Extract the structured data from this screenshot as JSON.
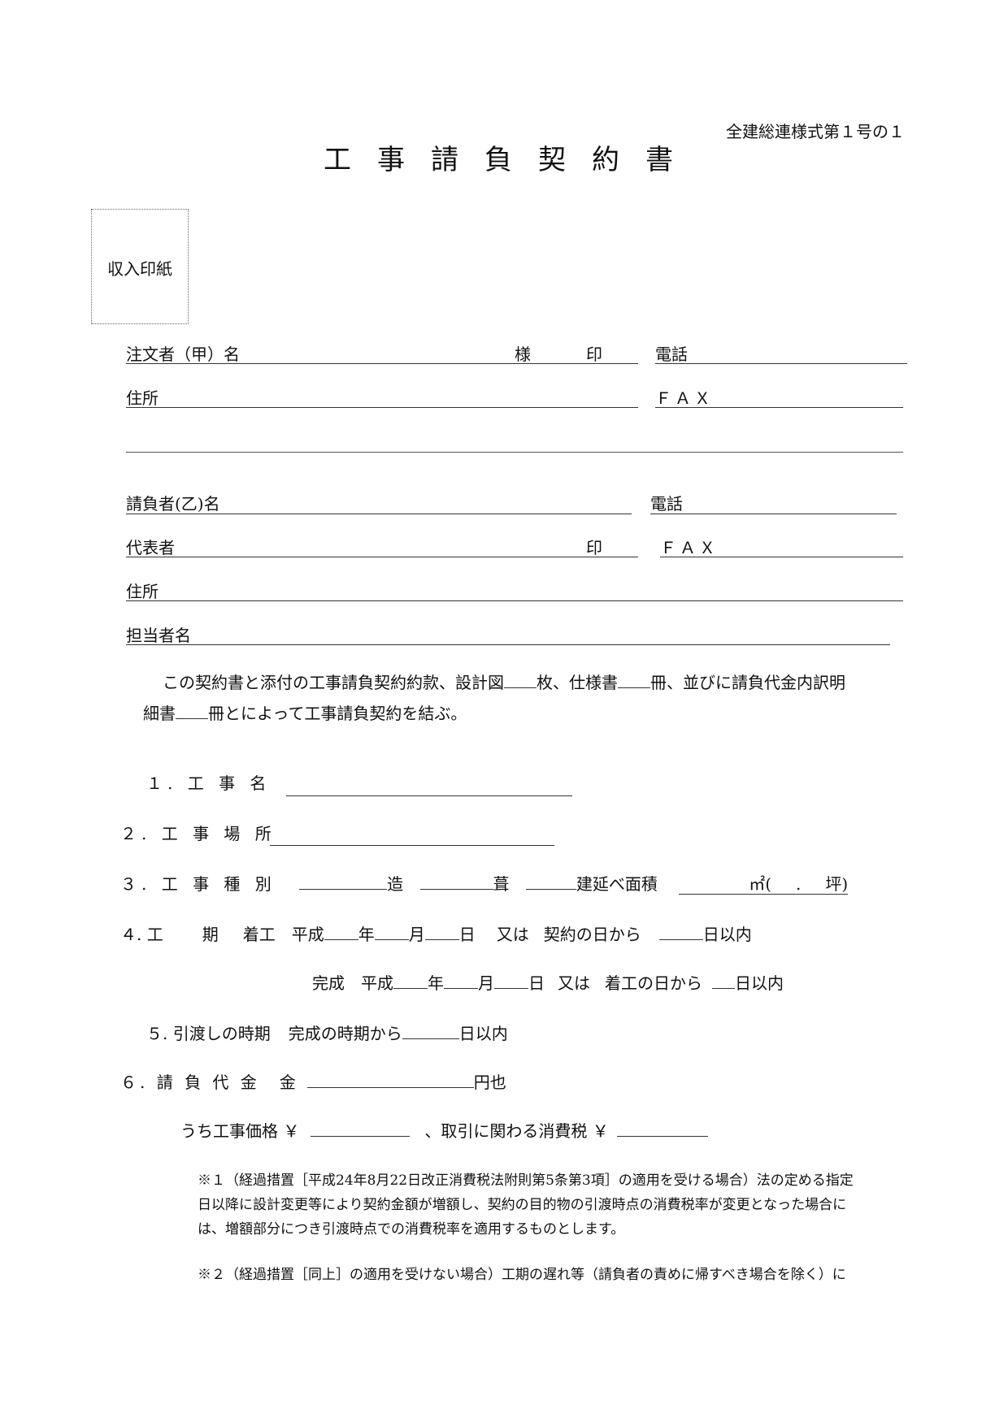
{
  "header": {
    "form_code": "全建総連様式第１号の１",
    "title": "工事請負契約書"
  },
  "stamp": {
    "label": "収入印紙"
  },
  "client": {
    "name_label": "注文者（甲）名",
    "honorific": "様",
    "seal": "印",
    "phone_label": "電話",
    "address_label": "住所",
    "fax_label": "ＦＡＸ",
    "name_value": "",
    "phone_value": "",
    "address_value": "",
    "fax_value": "",
    "address_line2_value": ""
  },
  "contractor": {
    "name_label": "請負者(乙)名",
    "phone_label": "電話",
    "rep_label": "代表者",
    "seal": "印",
    "fax_label": "ＦＡＸ",
    "address_label": "住所",
    "contact_label": "担当者名",
    "name_value": "",
    "phone_value": "",
    "rep_value": "",
    "fax_value": "",
    "address_value": "",
    "contact_value": ""
  },
  "agreement": {
    "p1": "この契約書と添付の工事請負契約約款、設計図",
    "unit_sheets": "枚、仕様書",
    "unit_volumes": "冊、並びに請負代金内訳明",
    "p2a": "細書",
    "p2b": "冊とによって工事請負契約を結ぶ。"
  },
  "items": {
    "i1": {
      "label": "１. 工 事 名",
      "value": ""
    },
    "i2": {
      "label": "２. 工 事 場 所",
      "value": ""
    },
    "i3": {
      "label": "３. 工 事 種 別",
      "structure": "造",
      "roof": "葺",
      "floor_area": "建延べ面積",
      "area_unit": "㎡(",
      "dot": ".",
      "tsubo": "坪)"
    },
    "i4": {
      "label": "４. 工",
      "label2": "期",
      "start": "着工",
      "era": "平成",
      "year": "年",
      "month": "月",
      "day": "日",
      "or": "又は",
      "from_contract": "契約の日から",
      "within": "日以内",
      "complete": "完成",
      "from_start": "着工の日から"
    },
    "i5": {
      "label": "５. 引渡しの時期",
      "text": "完成の時期から",
      "within": "日以内"
    },
    "i6": {
      "label": "６. 請 負 代 金　金",
      "unit": "円也",
      "price_label": "うち工事価格 ￥",
      "tax_label": "、取引に関わる消費税 ￥"
    }
  },
  "notes": [
    {
      "lines": [
        "※１（経過措置［平成24年8月22日改正消費税法附則第5条第3項］の適用を受ける場合）法の定める指定",
        "日以降に設計変更等により契約金額が増額し、契約の目的物の引渡時点の消費税率が変更となった場合に",
        "は、増額部分につき引渡時点での消費税率を適用するものとします。"
      ]
    },
    {
      "lines": [
        "※２（経過措置［同上］の適用を受けない場合）工期の遅れ等（請負者の責めに帰すべき場合を除く）に"
      ]
    }
  ]
}
